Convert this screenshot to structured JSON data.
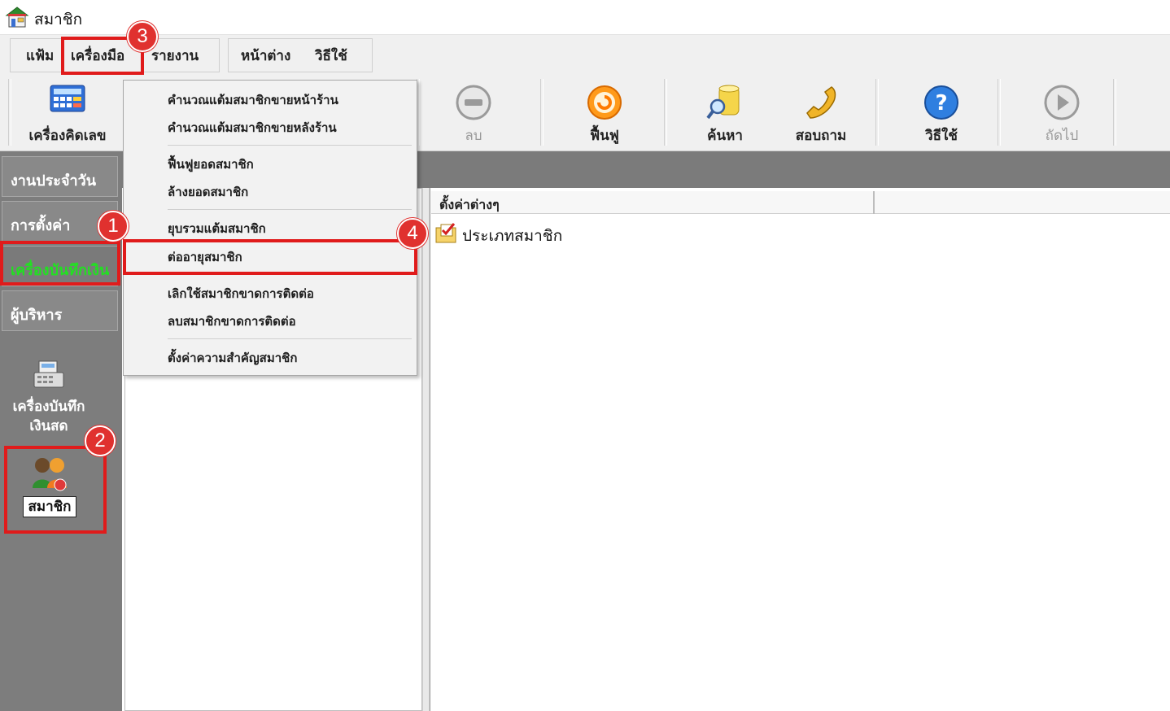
{
  "window": {
    "title": "สมาชิก",
    "icon": "shop-icon"
  },
  "menubar": {
    "items": [
      "แฟ้ม",
      "เครื่องมือ",
      "รายงาน",
      "หน้าต่าง",
      "วิธีใช้"
    ]
  },
  "toolbar": {
    "buttons": [
      {
        "label": "เครื่องคิดเลข",
        "icon": "calculator-icon",
        "enabled": true
      },
      {
        "label": "ลบ",
        "icon": "delete-circle-icon",
        "enabled": false
      },
      {
        "label": "ฟื้นฟู",
        "icon": "restore-icon",
        "enabled": true
      },
      {
        "label": "ค้นหา",
        "icon": "search-database-icon",
        "enabled": true
      },
      {
        "label": "สอบถาม",
        "icon": "phone-icon",
        "enabled": true
      },
      {
        "label": "วิธีใช้",
        "icon": "help-icon",
        "enabled": true
      },
      {
        "label": "ถัดไป",
        "icon": "next-icon",
        "enabled": false
      }
    ]
  },
  "sidebar": {
    "tabs": [
      "งานประจำวัน",
      "การตั้งค่า",
      "เครื่องบันทึกเงิน",
      "ผู้บริหาร"
    ],
    "active_tab": "เครื่องบันทึกเงิน",
    "icons": [
      {
        "label_line1": "เครื่องบันทึก",
        "label_line2": "เงินสด",
        "icon": "cash-register-icon"
      },
      {
        "label": "สมาชิก",
        "icon": "members-icon"
      }
    ]
  },
  "dropdown": {
    "items": [
      "คำนวณแต้มสมาชิกขายหน้าร้าน",
      "คำนวณแต้มสมาชิกขายหลังร้าน",
      "ฟื้นฟูยอดสมาชิก",
      "ล้างยอดสมาชิก",
      "ยุบรวมแต้มสมาชิก",
      "ต่ออายุสมาชิก",
      "เลิกใช้สมาชิกขาดการติดต่อ",
      "ลบสมาชิกขาดการติดต่อ",
      "ตั้งค่าความสำคัญสมาชิก"
    ],
    "highlighted": "ต่ออายุสมาชิก"
  },
  "content": {
    "column_header": "ตั้งค่าต่างๆ",
    "tree_item": "ประเภทสมาชิก"
  },
  "annotations": {
    "step1": "1",
    "step2": "2",
    "step3": "3",
    "step4": "4",
    "highlight_color": "#e01b1b"
  }
}
